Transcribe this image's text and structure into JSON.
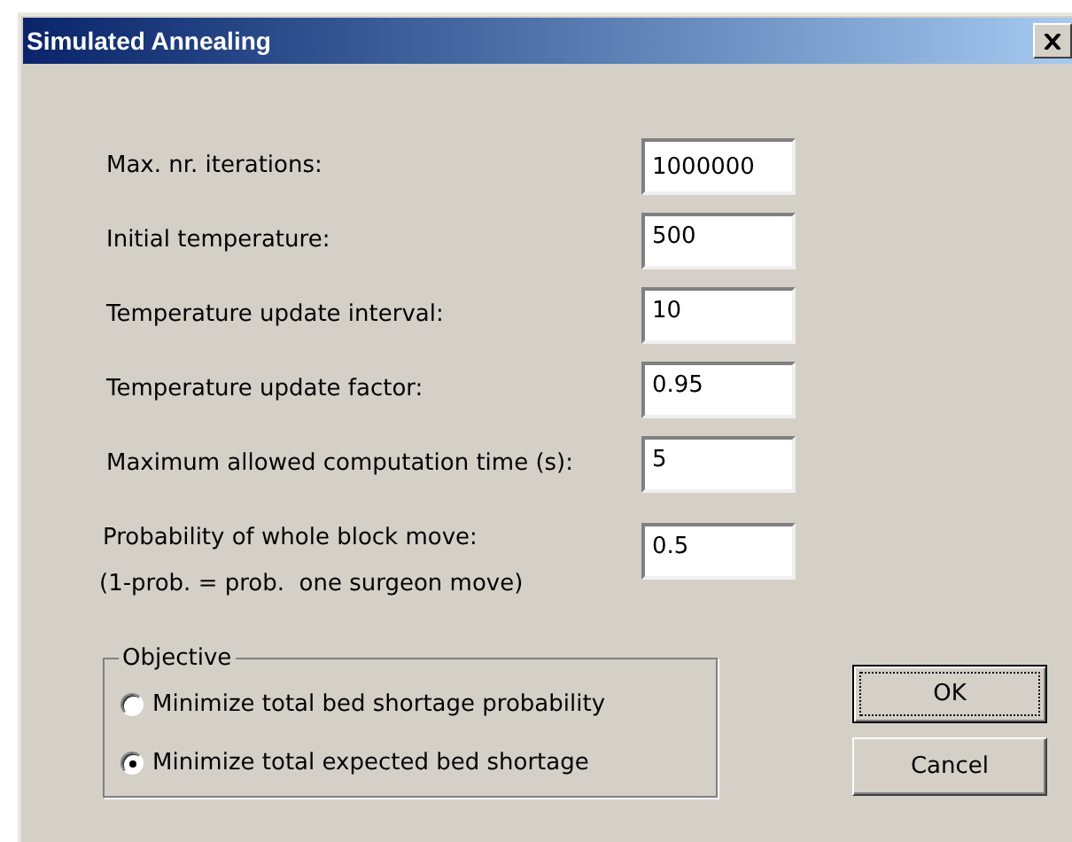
{
  "window": {
    "title": "Simulated Annealing"
  },
  "fields": [
    {
      "label": "Max. nr. iterations:",
      "value": "1000000"
    },
    {
      "label": "Initial temperature:",
      "value": "500"
    },
    {
      "label": "Temperature update interval:",
      "value": "10"
    },
    {
      "label": "Temperature update factor:",
      "value": "0.95"
    },
    {
      "label": "Maximum allowed computation time (s):",
      "value": "5"
    },
    {
      "label": "Probability of whole block move:",
      "note": "(1-prob. = prob.  one surgeon move)",
      "value": "0.5"
    }
  ],
  "objective": {
    "title": "Objective",
    "options": [
      {
        "label": "Minimize total bed shortage probability",
        "selected": false
      },
      {
        "label": "Minimize total expected bed shortage",
        "selected": true
      }
    ]
  },
  "buttons": [
    {
      "label": "OK",
      "default": true
    },
    {
      "label": "Cancel",
      "default": false
    }
  ]
}
